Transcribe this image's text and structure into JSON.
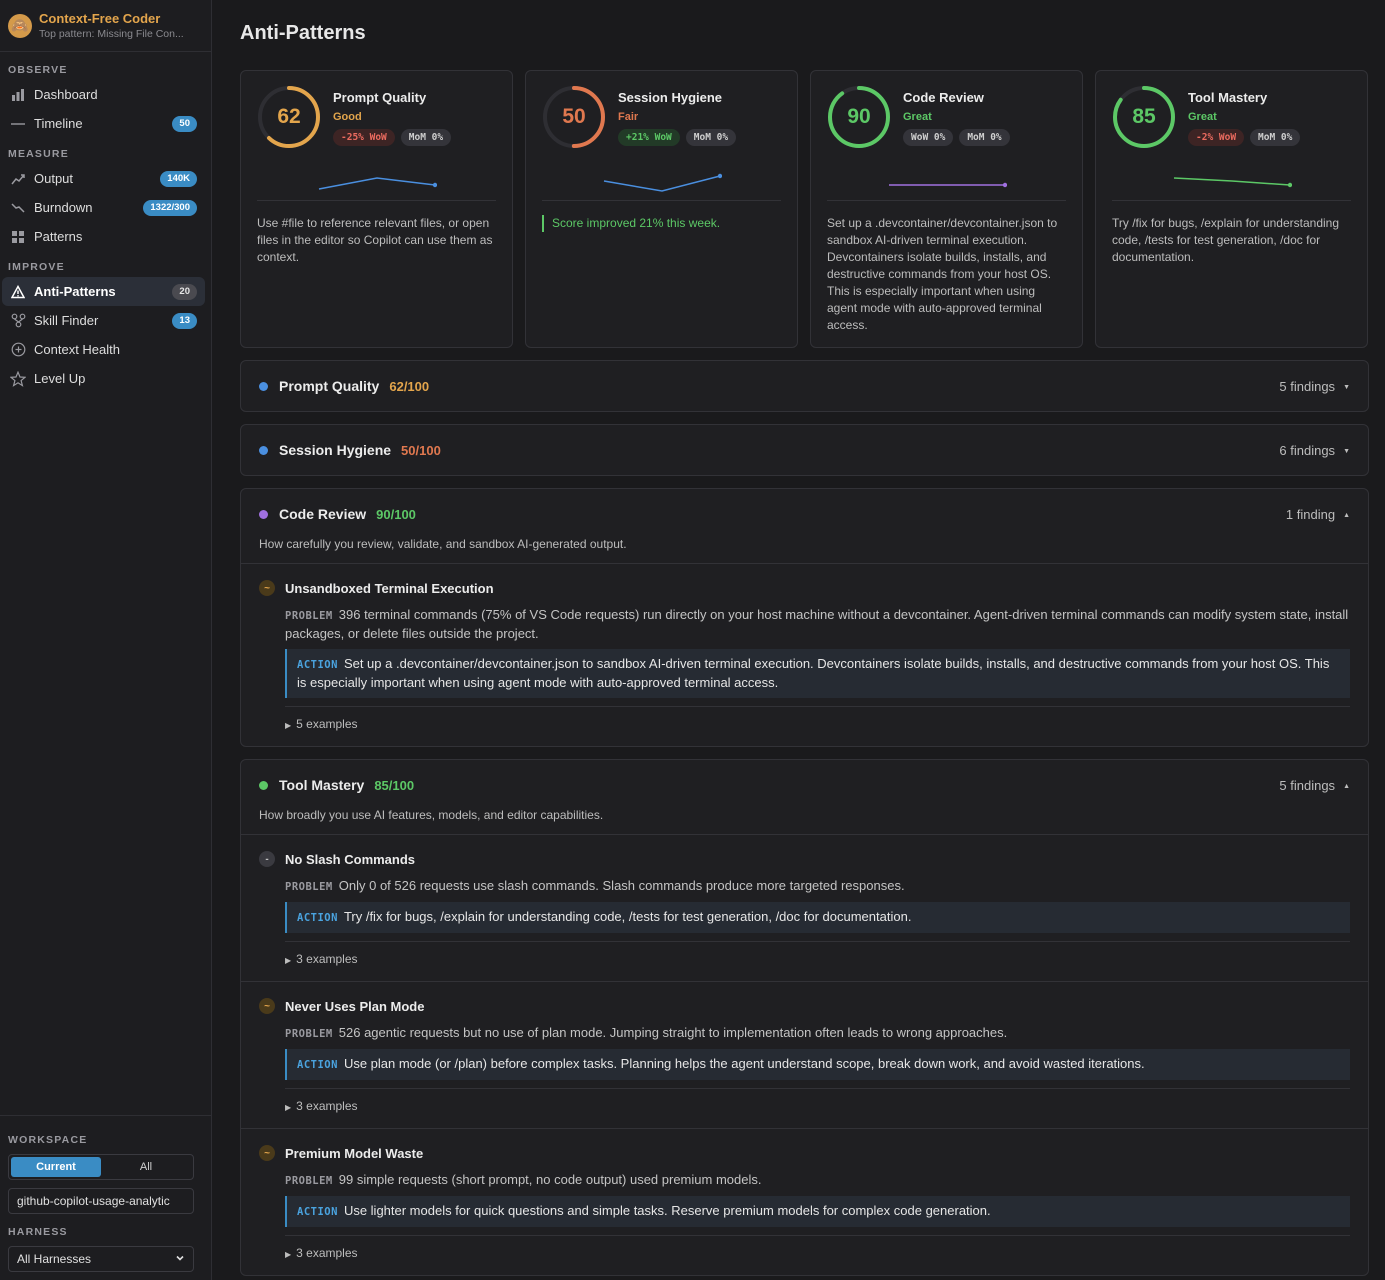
{
  "brand": {
    "title": "Context-Free Coder",
    "subtitle": "Top pattern: Missing File Con..."
  },
  "nav": {
    "observe_label": "OBSERVE",
    "measure_label": "MEASURE",
    "improve_label": "IMPROVE",
    "observe": [
      {
        "icon": "bar-chart-icon",
        "label": "Dashboard",
        "badge": ""
      },
      {
        "icon": "timeline-icon",
        "label": "Timeline",
        "badge": "50"
      }
    ],
    "measure": [
      {
        "icon": "trend-up-icon",
        "label": "Output",
        "badge": "140K"
      },
      {
        "icon": "trend-down-icon",
        "label": "Burndown",
        "badge": "1322/300"
      },
      {
        "icon": "grid-icon",
        "label": "Patterns",
        "badge": ""
      }
    ],
    "improve": [
      {
        "icon": "warning-icon",
        "label": "Anti-Patterns",
        "badge": "20",
        "active": true
      },
      {
        "icon": "skill-tree-icon",
        "label": "Skill Finder",
        "badge": "13"
      },
      {
        "icon": "plus-circle-icon",
        "label": "Context Health",
        "badge": ""
      },
      {
        "icon": "star-icon",
        "label": "Level Up",
        "badge": ""
      }
    ]
  },
  "workspace": {
    "label": "WORKSPACE",
    "seg_current": "Current",
    "seg_all": "All",
    "value": "github-copilot-usage-analytic",
    "harness_label": "HARNESS",
    "harness_value": "All Harnesses"
  },
  "page": {
    "title": "Anti-Patterns"
  },
  "cards": [
    {
      "score": "62",
      "title": "Prompt Quality",
      "grade": "Good",
      "grade_color": "#e3a54c",
      "ring_color": "#e3a54c",
      "ring_fraction": 0.62,
      "wow": "-25% WoW",
      "wow_kind": "red",
      "mom": "MoM 0%",
      "spark_color": "#4a8fe0",
      "spark": [
        0.3,
        0.85,
        0.5
      ],
      "body": "Use #file to reference relevant files, or open files in the editor so Copilot can use them as context."
    },
    {
      "score": "50",
      "title": "Session Hygiene",
      "grade": "Fair",
      "grade_color": "#e0784f",
      "ring_color": "#e0784f",
      "ring_fraction": 0.5,
      "wow": "+21% WoW",
      "wow_kind": "green",
      "mom": "MoM 0%",
      "spark_color": "#4a8fe0",
      "spark": [
        0.7,
        0.2,
        0.95
      ],
      "body": "Score improved 21% this week.",
      "note": true
    },
    {
      "score": "90",
      "title": "Code Review",
      "grade": "Great",
      "grade_color": "#5cc866",
      "ring_color": "#5cc866",
      "ring_fraction": 0.9,
      "wow": "WoW 0%",
      "wow_kind": "grey",
      "mom": "MoM 0%",
      "spark_color": "#a070e0",
      "spark": [
        0.5,
        0.5,
        0.5
      ],
      "body": "Set up a .devcontainer/devcontainer.json to sandbox AI-driven terminal execution. Devcontainers isolate builds, installs, and destructive commands from your host OS. This is especially important when using agent mode with auto-approved terminal access."
    },
    {
      "score": "85",
      "title": "Tool Mastery",
      "grade": "Great",
      "grade_color": "#5cc866",
      "ring_color": "#5cc866",
      "ring_fraction": 0.85,
      "wow": "-2% WoW",
      "wow_kind": "red",
      "mom": "MoM 0%",
      "spark_color": "#5cc866",
      "spark": [
        0.85,
        0.7,
        0.5
      ],
      "body": "Try /fix for bugs, /explain for understanding code, /tests for test generation, /doc for documentation."
    }
  ],
  "sections": [
    {
      "dot_color": "#4a8fe0",
      "title": "Prompt Quality",
      "score": "62/100",
      "score_color": "#e3a54c",
      "count": "5 findings",
      "expanded": false
    },
    {
      "dot_color": "#4a8fe0",
      "title": "Session Hygiene",
      "score": "50/100",
      "score_color": "#e0784f",
      "count": "6 findings",
      "expanded": false
    },
    {
      "dot_color": "#a070e0",
      "title": "Code Review",
      "score": "90/100",
      "score_color": "#5cc866",
      "count": "1 finding",
      "expanded": true,
      "desc": "How carefully you review, validate, and sandbox AI-generated output.",
      "findings": [
        {
          "severity": "warn",
          "glyph": "~",
          "title": "Unsandboxed Terminal Execution",
          "problem": "396 terminal commands (75% of VS Code requests) run directly on your host machine without a devcontainer. Agent-driven terminal commands can modify system state, install packages, or delete files outside the project.",
          "action": "Set up a .devcontainer/devcontainer.json to sandbox AI-driven terminal execution. Devcontainers isolate builds, installs, and destructive commands from your host OS. This is especially important when using agent mode with auto-approved terminal access.",
          "examples": "5 examples"
        }
      ]
    },
    {
      "dot_color": "#5cc866",
      "title": "Tool Mastery",
      "score": "85/100",
      "score_color": "#5cc866",
      "count": "5 findings",
      "expanded": true,
      "desc": "How broadly you use AI features, models, and editor capabilities.",
      "findings": [
        {
          "severity": "low",
          "glyph": "-",
          "title": "No Slash Commands",
          "problem": "Only 0 of 526 requests use slash commands. Slash commands produce more targeted responses.",
          "action": "Try /fix for bugs, /explain for understanding code, /tests for test generation, /doc for documentation.",
          "examples": "3 examples"
        },
        {
          "severity": "warn",
          "glyph": "~",
          "title": "Never Uses Plan Mode",
          "problem": "526 agentic requests but no use of plan mode. Jumping straight to implementation often leads to wrong approaches.",
          "action": "Use plan mode (or /plan) before complex tasks. Planning helps the agent understand scope, break down work, and avoid wasted iterations.",
          "examples": "3 examples"
        },
        {
          "severity": "warn",
          "glyph": "~",
          "title": "Premium Model Waste",
          "problem": "99 simple requests (short prompt, no code output) used premium models.",
          "action": "Use lighter models for quick questions and simple tasks. Reserve premium models for complex code generation.",
          "examples": "3 examples"
        }
      ]
    }
  ],
  "labels": {
    "problem": "PROBLEM",
    "action": "ACTION"
  }
}
